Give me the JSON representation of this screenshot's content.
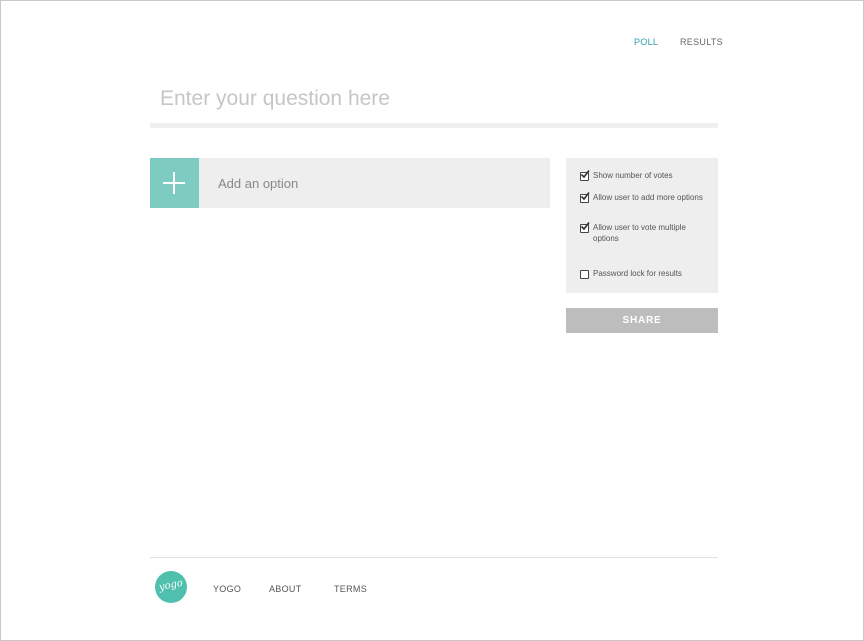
{
  "nav": {
    "poll_label": "POLL",
    "results_label": "RESULTS"
  },
  "question": {
    "placeholder": "Enter your question here",
    "value": ""
  },
  "option": {
    "placeholder": "Add an option",
    "add_icon": "plus-icon"
  },
  "settings": {
    "items": [
      {
        "label": "Show number of votes",
        "checked": true
      },
      {
        "label": "Allow user to add more options",
        "checked": true
      },
      {
        "label": "Allow user to vote multiple options",
        "checked": true
      },
      {
        "label": "Password lock for results",
        "checked": false
      }
    ]
  },
  "share_label": "SHARE",
  "footer": {
    "logo_text": "yogo",
    "links": [
      "YOGO",
      "ABOUT",
      "TERMS"
    ]
  },
  "colors": {
    "accent": "#2a9fa5",
    "add_button": "#7ecbc1",
    "logo": "#4fbfae",
    "panel": "#eeeeee",
    "share_button": "#bdbdbd"
  }
}
